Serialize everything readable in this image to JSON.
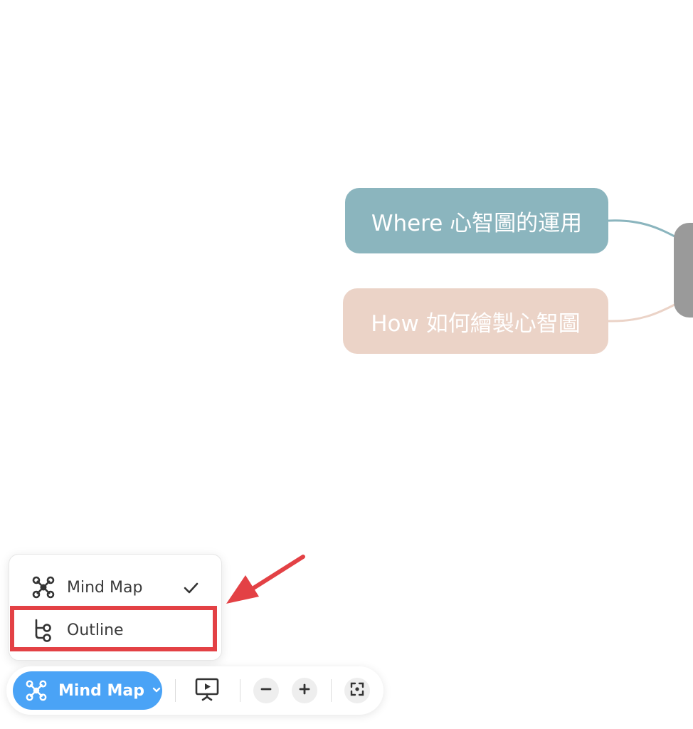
{
  "mindmap": {
    "nodes": {
      "where": "Where 心智圖的運用",
      "how": "How 如何繪製心智圖"
    },
    "colors": {
      "where": "#8bb5be",
      "how": "#ebd3c7",
      "center": "#9a9a9a"
    }
  },
  "view_menu": {
    "items": [
      {
        "label": "Mind Map",
        "icon": "mindmap-icon",
        "selected": true
      },
      {
        "label": "Outline",
        "icon": "outline-icon",
        "selected": false
      }
    ]
  },
  "toolbar": {
    "mode_label": "Mind Map",
    "mode_icon": "mindmap-icon",
    "present_icon": "presentation-icon",
    "zoom_out_icon": "minus-icon",
    "zoom_in_icon": "plus-icon",
    "fit_icon": "focus-icon",
    "accent": "#4aa3f6"
  },
  "annotation": {
    "highlight_color": "#e34145"
  }
}
